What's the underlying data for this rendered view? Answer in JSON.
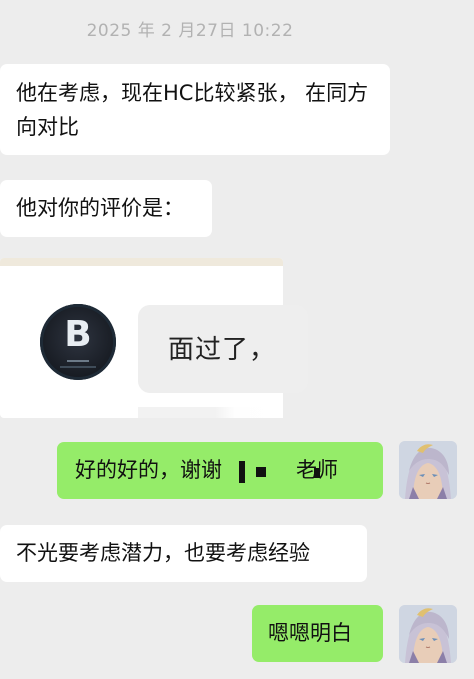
{
  "chat": {
    "timestamp": "2025 年 2 月27日 10:22",
    "messages": [
      {
        "side": "left",
        "type": "text",
        "text": "他在考虑，现在HC比较紧张， 在同方向对比"
      },
      {
        "side": "left",
        "type": "text",
        "text": "他对你的评价是："
      },
      {
        "side": "left",
        "type": "image",
        "logo_text": "B",
        "caption": "面过了，"
      },
      {
        "side": "right",
        "type": "text",
        "text_before": "好的好的，谢谢",
        "text_after": "老师"
      },
      {
        "side": "left",
        "type": "text",
        "text": "不光要考虑潜力，也要考虑经验"
      },
      {
        "side": "right",
        "type": "text",
        "text": "嗯嗯明白"
      }
    ]
  },
  "colors": {
    "background": "#ededed",
    "incoming_bubble": "#ffffff",
    "outgoing_bubble": "#95ec69",
    "timestamp_text": "#b2b2b2"
  },
  "icons": {
    "avatar": "anime-girl-avatar",
    "logo": "b-logo-icon"
  }
}
